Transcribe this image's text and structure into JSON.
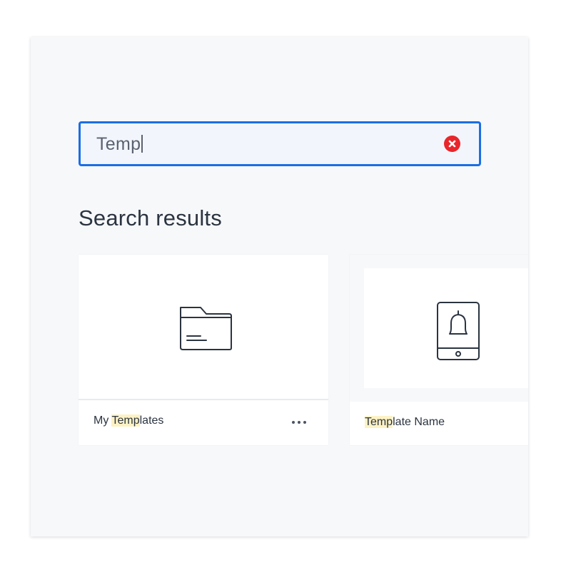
{
  "search": {
    "value": "Temp",
    "clear_icon": "close-circle-icon",
    "clear_color": "#e8262c",
    "border_color": "#1a6ee6"
  },
  "results": {
    "title": "Search results",
    "items": [
      {
        "type": "folder",
        "icon": "folder-icon",
        "name_prefix": "My ",
        "name_highlight": "Temp",
        "name_suffix": "lates",
        "menu_icon": "more-horizontal-icon"
      },
      {
        "type": "template",
        "icon": "mobile-notification-icon",
        "name_prefix": "",
        "name_highlight": "Temp",
        "name_suffix": "late Name"
      }
    ],
    "highlight_color": "#fdf2c4"
  }
}
